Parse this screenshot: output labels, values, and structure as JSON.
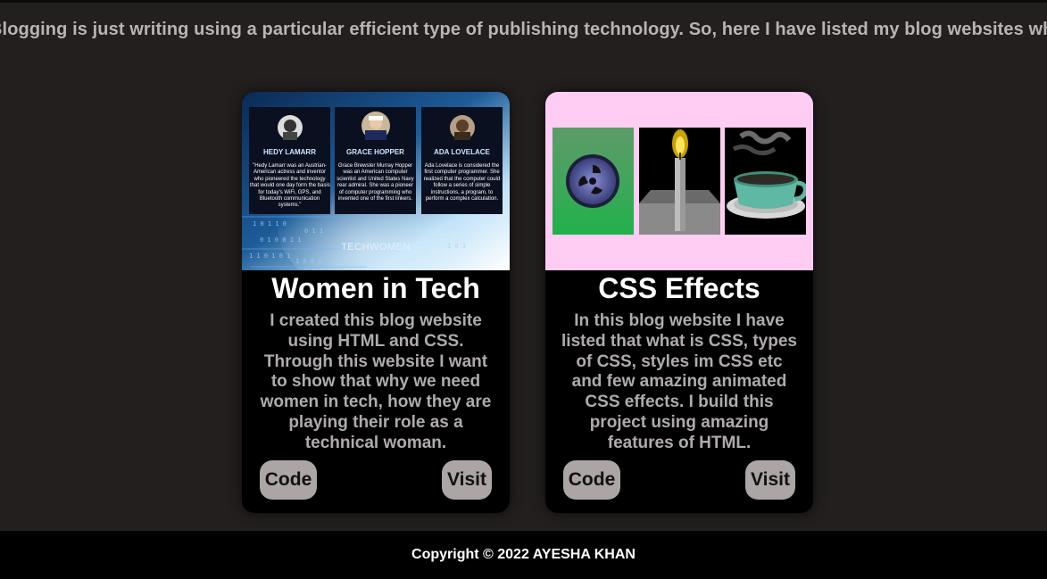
{
  "marquee": {
    "text": "Blogging is just writing using a particular efficient type of publishing technology. So, here I have listed my blog websites which"
  },
  "cards": [
    {
      "title": "Women in Tech",
      "description": "I created this blog website using HTML and CSS. Through this website I want to show that why we need women in tech, how they are playing their role as a technical woman.",
      "code_label": "Code",
      "visit_label": "Visit",
      "image": {
        "panels": [
          {
            "name": "HEDY LAMARR",
            "text": [
              "\"Hedy Lamarr was an Austrian-",
              "American actress and inventor",
              "who pioneered the technology",
              "that would one day form the basis",
              "for today's WiFi, GPS, and",
              "Bluetooth communication",
              "systems.\""
            ]
          },
          {
            "name": "GRACE HOPPER",
            "text": [
              "Grace Brewster Murray Hopper",
              "was an American computer",
              "scientist and United States Navy",
              "rear admiral. She was a pioneer",
              "of computer programming who",
              "invented one of the first linkers."
            ]
          },
          {
            "name": "ADA LOVELACE",
            "text": [
              "Ada Lovelace is considered the",
              "first computer programmer. She",
              "realized that the computer could",
              "follow a series of simple",
              "instructions, a program, to",
              "perform a complex calculation."
            ]
          }
        ],
        "logo": "TECHWOMEN"
      }
    },
    {
      "title": "CSS Effects",
      "description": "In this blog website I have listed that what is CSS, types of CSS, styles im CSS etc and few amazing animated CSS effects. I build this project using amazing features of HTML.",
      "code_label": "Code",
      "visit_label": "Visit",
      "image": {
        "background": "#ffcdf3"
      }
    }
  ],
  "footer": {
    "text": "Copyright © 2022 AYESHA KHAN"
  },
  "colors": {
    "page_background": "#231f1f",
    "card_background": "#000000",
    "button_background": "#aba5a5",
    "muted_text": "#b0abab"
  }
}
